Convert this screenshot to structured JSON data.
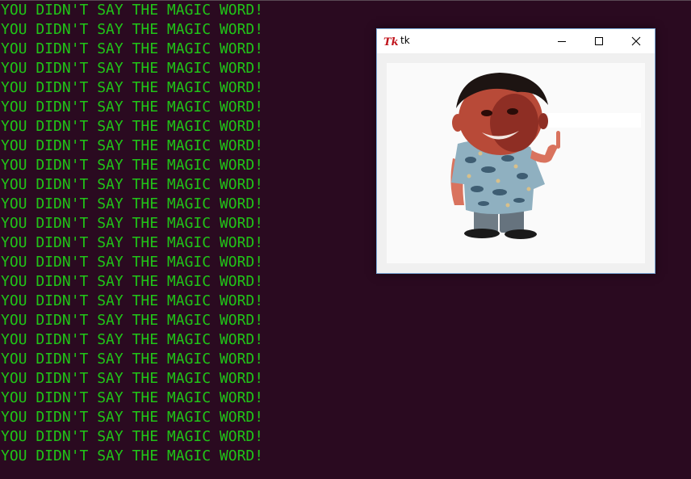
{
  "terminal": {
    "lines": [
      "YOU DIDN'T SAY THE MAGIC WORD!",
      "YOU DIDN'T SAY THE MAGIC WORD!",
      "YOU DIDN'T SAY THE MAGIC WORD!",
      "YOU DIDN'T SAY THE MAGIC WORD!",
      "YOU DIDN'T SAY THE MAGIC WORD!",
      "YOU DIDN'T SAY THE MAGIC WORD!",
      "YOU DIDN'T SAY THE MAGIC WORD!",
      "YOU DIDN'T SAY THE MAGIC WORD!",
      "YOU DIDN'T SAY THE MAGIC WORD!",
      "YOU DIDN'T SAY THE MAGIC WORD!",
      "YOU DIDN'T SAY THE MAGIC WORD!",
      "YOU DIDN'T SAY THE MAGIC WORD!",
      "YOU DIDN'T SAY THE MAGIC WORD!",
      "YOU DIDN'T SAY THE MAGIC WORD!",
      "YOU DIDN'T SAY THE MAGIC WORD!",
      "YOU DIDN'T SAY THE MAGIC WORD!",
      "YOU DIDN'T SAY THE MAGIC WORD!",
      "YOU DIDN'T SAY THE MAGIC WORD!",
      "YOU DIDN'T SAY THE MAGIC WORD!",
      "YOU DIDN'T SAY THE MAGIC WORD!",
      "YOU DIDN'T SAY THE MAGIC WORD!",
      "YOU DIDN'T SAY THE MAGIC WORD!",
      "YOU DIDN'T SAY THE MAGIC WORD!",
      "YOU DIDN'T SAY THE MAGIC WORD!"
    ],
    "text_color": "#21c418",
    "background": "#2a0a20"
  },
  "tk_window": {
    "title": "tk",
    "icons": {
      "app": "tk-feather-icon",
      "minimize": "minimize-icon",
      "maximize": "maximize-icon",
      "close": "close-icon"
    },
    "image_subject": "cartoon-man-wagging-finger"
  }
}
